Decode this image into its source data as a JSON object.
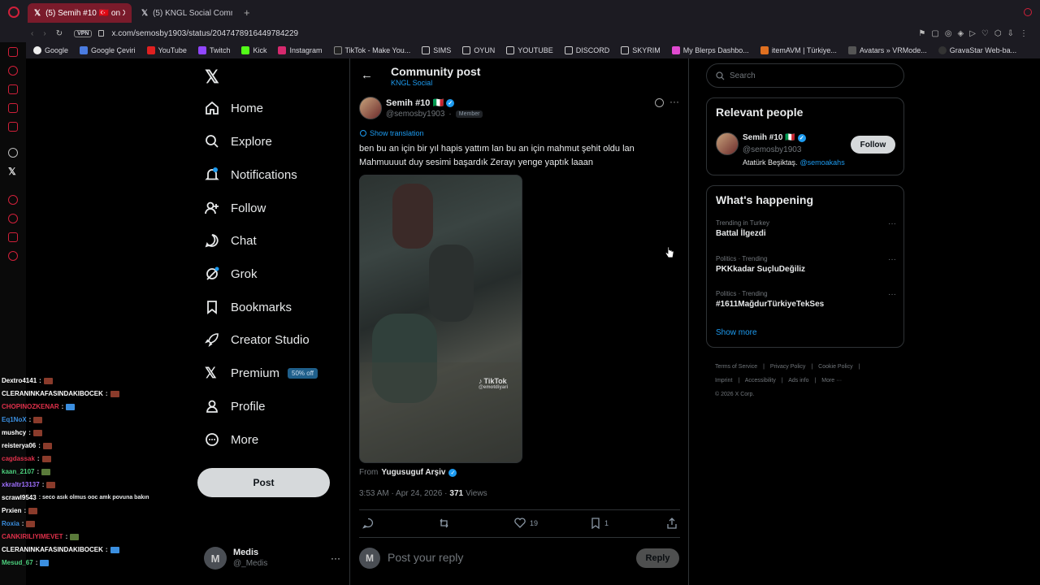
{
  "browser": {
    "tabs": [
      {
        "label": "(5) Semih #10 🇹🇷 on X:",
        "active": true
      },
      {
        "label": "(5) KNGL Social Communi",
        "active": false
      }
    ],
    "vpn_label": "VPN",
    "url": "x.com/semosby1903/status/2047478916449784229",
    "bookmarks": [
      "Google",
      "Google Çeviri",
      "YouTube",
      "Twitch",
      "Kick",
      "Instagram",
      "TikTok - Make You...",
      "SIMS",
      "OYUN",
      "YOUTUBE",
      "DISCORD",
      "SKYRIM",
      "My Blerps Dashbo...",
      "itemAVM | Türkiye...",
      "Avatars » VRMode...",
      "GravaStar Web-ba..."
    ]
  },
  "nav": {
    "items": [
      {
        "label": "Home",
        "icon": "home-icon"
      },
      {
        "label": "Explore",
        "icon": "search-icon"
      },
      {
        "label": "Notifications",
        "icon": "bell-icon"
      },
      {
        "label": "Follow",
        "icon": "person-add-icon"
      },
      {
        "label": "Chat",
        "icon": "chat-icon"
      },
      {
        "label": "Grok",
        "icon": "grok-icon"
      },
      {
        "label": "Bookmarks",
        "icon": "bookmark-icon"
      },
      {
        "label": "Creator Studio",
        "icon": "rocket-icon"
      },
      {
        "label": "Premium",
        "icon": "x-icon"
      },
      {
        "label": "Profile",
        "icon": "person-icon"
      },
      {
        "label": "More",
        "icon": "more-circle-icon"
      }
    ],
    "premium_badge": "50% off",
    "post_button": "Post",
    "account": {
      "name": "Medis",
      "handle": "@_Medis",
      "initial": "M"
    }
  },
  "chat": [
    {
      "user": "Dextro4141",
      "color": "#ffffff",
      "msg": ":",
      "emote": true
    },
    {
      "user": "CLERANINKAFASINDAKIBOCEK",
      "color": "#ffffff",
      "msg": ":",
      "emote": true
    },
    {
      "user": "CHOPINOZKENAR",
      "color": "#e0304a",
      "msg": ":",
      "emote": true
    },
    {
      "user": "Eq1NoX",
      "color": "#3b8fe0",
      "msg": ":",
      "emote": true
    },
    {
      "user": "mushcy",
      "color": "#ffffff",
      "msg": ":",
      "emote": true
    },
    {
      "user": "reisterya06",
      "color": "#ffffff",
      "msg": ":",
      "emote": true
    },
    {
      "user": "cagdassak",
      "color": "#e0304a",
      "msg": ":",
      "emote": true
    },
    {
      "user": "kaan_2107",
      "color": "#4cd07d",
      "msg": ":",
      "emote": true
    },
    {
      "user": "xkraltr13137",
      "color": "#a070ff",
      "msg": ":",
      "emote": true
    },
    {
      "user": "scrawl9543",
      "color": "#ffffff",
      "msg": ": seco asık olmus ooc amk povuna bakın",
      "emote": false
    },
    {
      "user": "Prxien",
      "color": "#ffffff",
      "msg": ":",
      "emote": true
    },
    {
      "user": "Roxia",
      "color": "#3b8fe0",
      "msg": ":",
      "emote": true
    },
    {
      "user": "CANKIRILIYIMEVET",
      "color": "#e0304a",
      "msg": ":",
      "emote": true
    },
    {
      "user": "CLERANINKAFASINDAKIBOCEK",
      "color": "#ffffff",
      "msg": ":",
      "emote": true
    },
    {
      "user": "Mesud_67",
      "color": "#4cd07d",
      "msg": ":",
      "emote": true
    }
  ],
  "post": {
    "header_title": "Community post",
    "header_sub": "KNGL Social",
    "author_name": "Semih #10 🇮🇹",
    "author_handle": "@semosby1903",
    "member_badge": "Member",
    "show_translation": "Show translation",
    "text": "ben bu an için bir yıl hapis yattım lan bu an için mahmut şehit oldu lan Mahmuuuut duy sesimi başardık Zerayı yenge yaptık laaan",
    "video_watermark": "TikTok",
    "video_watermark_handle": "@emotdiyari",
    "from_label": "From",
    "from_account": "Yugusuguf Arşiv",
    "time": "3:53 AM · Apr 24, 2026 ·",
    "views_count": "371",
    "views_label": "Views",
    "likes": "19",
    "bookmarks": "1",
    "reply_placeholder": "Post your reply",
    "reply_button": "Reply",
    "reply_avatar": "M"
  },
  "right": {
    "search_placeholder": "Search",
    "relevant_title": "Relevant people",
    "person_name": "Semih #10 🇮🇹",
    "person_handle": "@semosby1903",
    "person_bio": "Atatürk Beşiktaş.",
    "person_bio_link": "@semoakahs",
    "follow_button": "Follow",
    "happening_title": "What's happening",
    "trends": [
      {
        "context": "Trending in Turkey",
        "title": "Battal İlgezdi"
      },
      {
        "context": "Politics · Trending",
        "title": "PKKkadar SuçluDeğiliz"
      },
      {
        "context": "Politics · Trending",
        "title": "#1611MağdurTürkiyeTekSes"
      }
    ],
    "show_more": "Show more",
    "footer": [
      "Terms of Service",
      "Privacy Policy",
      "Cookie Policy",
      "Imprint",
      "Accessibility",
      "Ads info",
      "More ···",
      "© 2026 X Corp."
    ]
  },
  "colors": {
    "accent": "#1d9bf0",
    "browser_accent": "#d0203a",
    "tab_active": "#7a1b2b"
  }
}
